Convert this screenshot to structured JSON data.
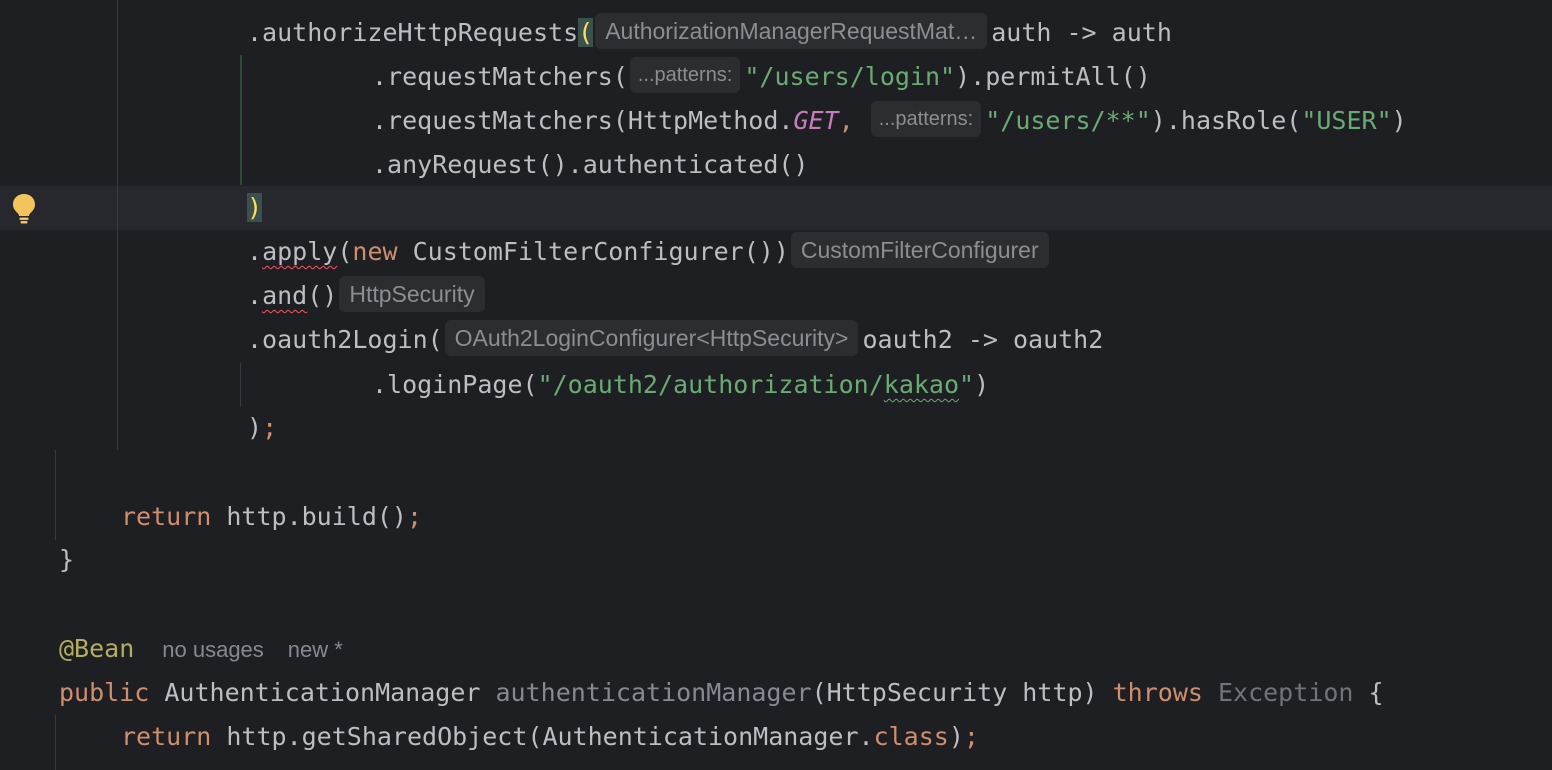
{
  "code": {
    "l1": {
      "method": ".authorizeHttpRequests",
      "open_paren": "(",
      "hint": "AuthorizationManagerRequestMat…",
      "lambda": "auth -> auth"
    },
    "l2": {
      "method": ".requestMatchers(",
      "hint": "...patterns:",
      "arg": "\"/users/login\"",
      "tail": ").permitAll()"
    },
    "l3": {
      "method": ".requestMatchers(HttpMethod.",
      "const": "GET",
      "comma": ",",
      "hint": "...patterns:",
      "arg": "\"/users/**\"",
      "tail": ").hasRole(",
      "role": "\"USER\"",
      "close": ")"
    },
    "l4": {
      "text": ".anyRequest().authenticated()"
    },
    "l5": {
      "close_paren": ")"
    },
    "l6": {
      "dot": ".",
      "method": "apply",
      "open": "(",
      "kw_new": "new",
      "ctor": " CustomFilterConfigurer())",
      "hint": "CustomFilterConfigurer"
    },
    "l7": {
      "dot": ".",
      "method": "and",
      "call": "()",
      "hint": "HttpSecurity"
    },
    "l8": {
      "method": ".oauth2Login(",
      "hint": "OAuth2LoginConfigurer<HttpSecurity>",
      "lambda": "oauth2 -> oauth2"
    },
    "l9": {
      "method": ".loginPage(",
      "str_a": "\"/oauth2/authorization/",
      "str_b": "kakao",
      "str_c": "\"",
      "close": ")"
    },
    "l10": {
      "close": ")",
      "semi": ";"
    },
    "l11": {
      "kw_return": "return",
      "expr": " http.build()",
      "semi": ";"
    },
    "l12": {
      "brace": "}"
    },
    "l13": {
      "annotation": "@Bean",
      "usages": "no usages",
      "author": "new *"
    },
    "l14": {
      "kw_public": "public",
      "type": " AuthenticationManager ",
      "name": "authenticationManager",
      "params": "(HttpSecurity http) ",
      "kw_throws": "throws",
      "exception": " Exception",
      "brace": " {"
    },
    "l15": {
      "kw_return": "return",
      "expr": " http.getSharedObject(AuthenticationManager.",
      "kw_class": "class",
      "close": ")",
      "semi": ";"
    }
  },
  "colors": {
    "background": "#1e1f22",
    "current_line": "#26282e",
    "keyword": "#cf8e6d",
    "string": "#6aab73",
    "annotation": "#b3ae60",
    "constant": "#c77dbb",
    "text": "#bcbec4",
    "hint_bg": "#2b2d30"
  },
  "gutter": {
    "icon": "lightbulb-icon"
  }
}
